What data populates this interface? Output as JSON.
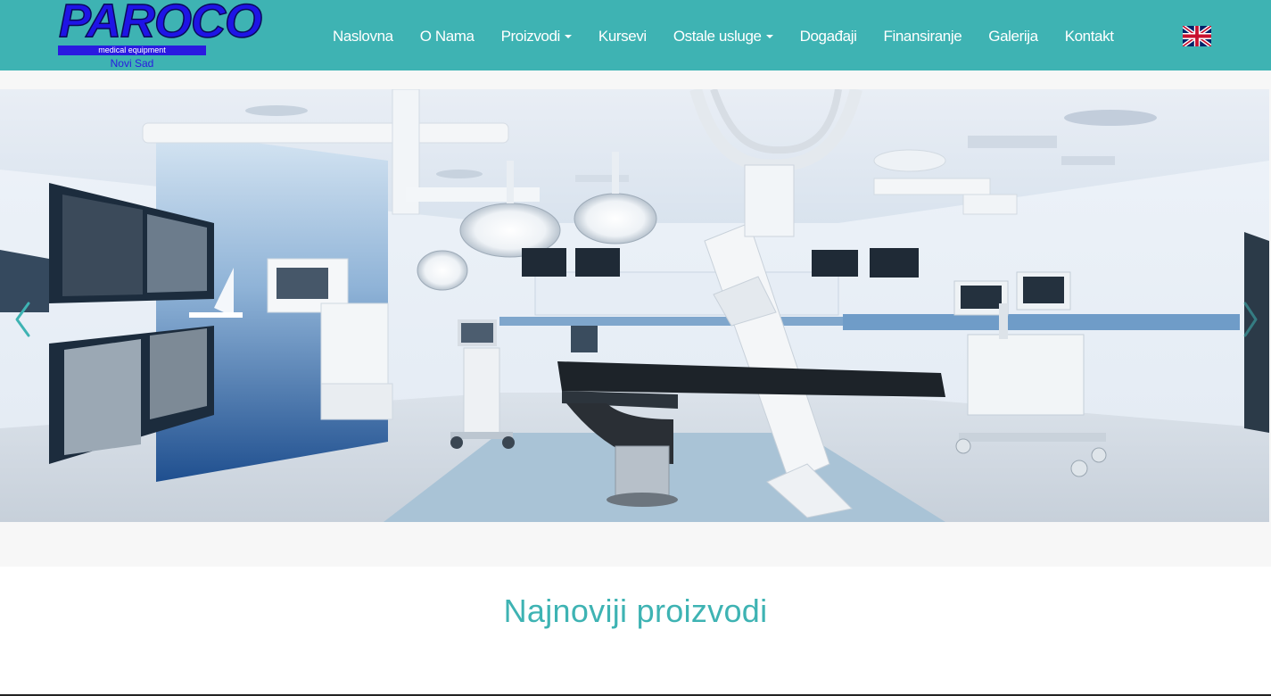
{
  "brand": {
    "name": "PAROCO",
    "tagline": "medical equipment",
    "city": "Novi Sad"
  },
  "nav": {
    "items": [
      {
        "label": "Naslovna"
      },
      {
        "label": "O Nama"
      },
      {
        "label": "Proizvodi",
        "dropdown": true
      },
      {
        "label": "Kursevi"
      },
      {
        "label": "Ostale usluge",
        "dropdown": true
      },
      {
        "label": "Događaji"
      },
      {
        "label": "Finansiranje"
      },
      {
        "label": "Galerija"
      },
      {
        "label": "Kontakt"
      }
    ],
    "language_icon": "uk-flag-icon"
  },
  "carousel": {
    "prev_icon": "chevron-left-icon",
    "next_icon": "chevron-right-icon"
  },
  "section": {
    "title": "Najnoviji proizvodi"
  },
  "colors": {
    "primary": "#3eb3b3",
    "logo": "#2a1ae0",
    "light_gray": "#f7f7f7"
  }
}
